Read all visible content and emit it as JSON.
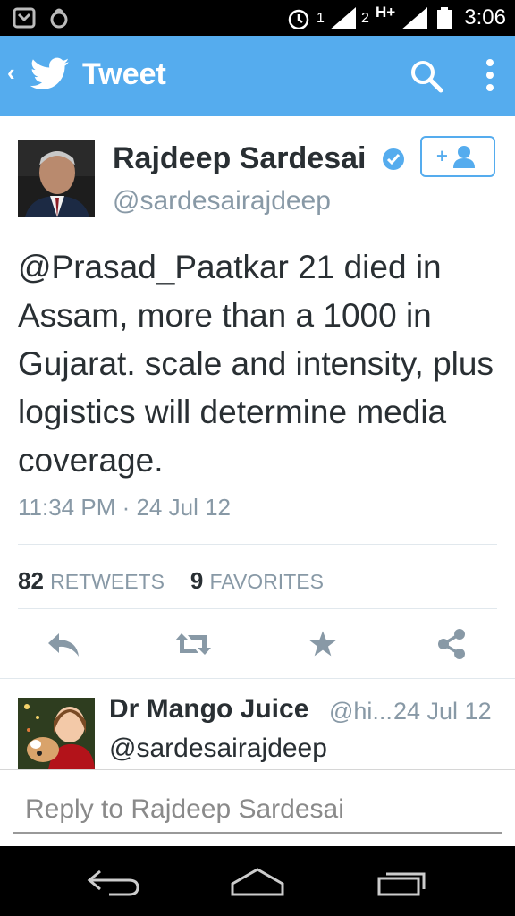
{
  "status_bar": {
    "time": "3:06",
    "sim1_label": "1",
    "sim2_label": "2",
    "network_type": "H+",
    "icons": [
      "notification-icon",
      "lock-icon",
      "alarm-icon",
      "signal-icon",
      "battery-icon"
    ]
  },
  "action_bar": {
    "back_glyph": "‹",
    "title": "Tweet",
    "icons": [
      "twitter-bird-icon",
      "search-icon",
      "overflow-menu-icon"
    ]
  },
  "tweet": {
    "author_name": "Rajdeep Sardesai",
    "author_handle": "@sardesairajdeep",
    "verified": true,
    "text": "@Prasad_Paatkar 21 died in Assam, more than a 1000 in Gujarat. scale and intensity, plus logistics will determine media coverage.",
    "timestamp": "11:34 PM · 24 Jul 12",
    "retweets_count": "82",
    "retweets_label": "RETWEETS",
    "favorites_count": "9",
    "favorites_label": "FAVORITES"
  },
  "actions": [
    "reply-icon",
    "retweet-icon",
    "favorite-icon",
    "share-icon"
  ],
  "reply_item": {
    "name": "Dr Mango Juice",
    "handle": "@hi...",
    "date": "24 Jul 12",
    "text": "@sardesairajdeep"
  },
  "reply_box": {
    "placeholder": "Reply to Rajdeep Sardesai"
  },
  "colors": {
    "accent": "#55acee",
    "text": "#292f33",
    "muted": "#8899a6",
    "action_icon": "#8899a6"
  }
}
